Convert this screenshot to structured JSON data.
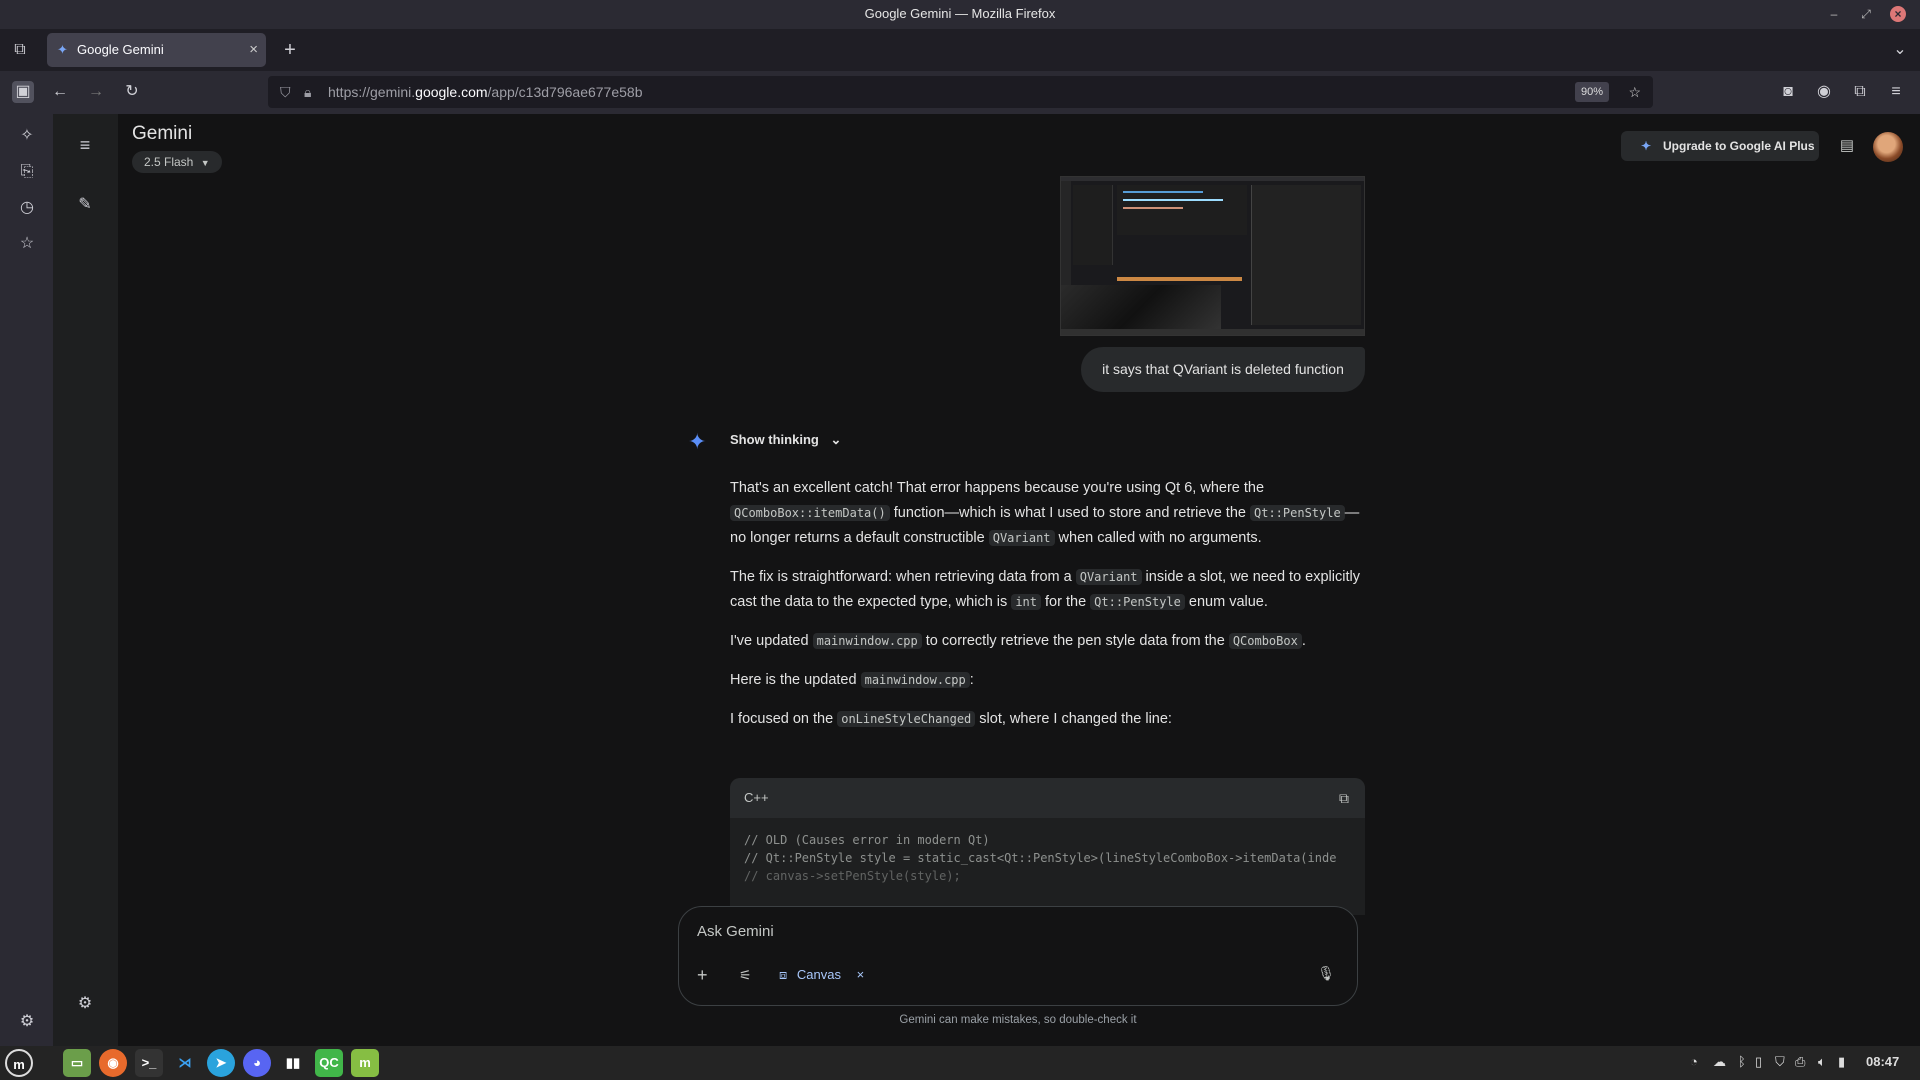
{
  "window": {
    "title": "Google Gemini — Mozilla Firefox"
  },
  "tab": {
    "title": "Google Gemini"
  },
  "url": {
    "prefix": "https://gemini.",
    "host": "google.com",
    "path": "/app/c13d796ae677e58b",
    "zoom": "90%"
  },
  "gemini": {
    "title": "Gemini",
    "model": "2.5 Flash",
    "upgrade_label": "Upgrade to Google AI Plus"
  },
  "conversation": {
    "user_message": "it says that QVariant is deleted function",
    "show_thinking": "Show thinking",
    "response": {
      "p1": [
        "That's an excellent catch! That error happens because you're using Qt 6, where the ",
        "QComboBox::itemData()",
        " function—which is what I used to store and retrieve the ",
        "Qt::PenStyle",
        "—no longer returns a default constructible ",
        "QVariant",
        " when called with no arguments."
      ],
      "p2": [
        "The fix is straightforward: when retrieving data from a ",
        "QVariant",
        " inside a slot, we need to explicitly cast the data to the expected type, which is ",
        "int",
        " for the ",
        "Qt::PenStyle",
        " enum value."
      ],
      "p3": [
        "I've updated ",
        "mainwindow.cpp",
        " to correctly retrieve the pen style data from the ",
        "QComboBox",
        "."
      ],
      "p4": [
        "Here is the updated ",
        "mainwindow.cpp",
        ":"
      ],
      "p5": [
        "I focused on the ",
        "onLineStyleChanged",
        " slot, where I changed the line:"
      ]
    },
    "code": {
      "language": "C++",
      "lines": [
        "// OLD (Causes error in modern Qt)",
        "// Qt::PenStyle style = static_cast<Qt::PenStyle>(lineStyleComboBox->itemData(inde",
        "// canvas->setPenStyle(style);"
      ]
    }
  },
  "input": {
    "placeholder": "Ask Gemini",
    "canvas_chip": "Canvas",
    "disclaimer": "Gemini can make mistakes, so double-check it"
  },
  "taskbar": {
    "clock": "08:47"
  },
  "icons": [
    "menu-icon",
    "new-chat-icon",
    "settings-icon",
    "gemini-star-icon",
    "copy-icon",
    "plus-icon",
    "tools-icon",
    "mic-icon"
  ]
}
